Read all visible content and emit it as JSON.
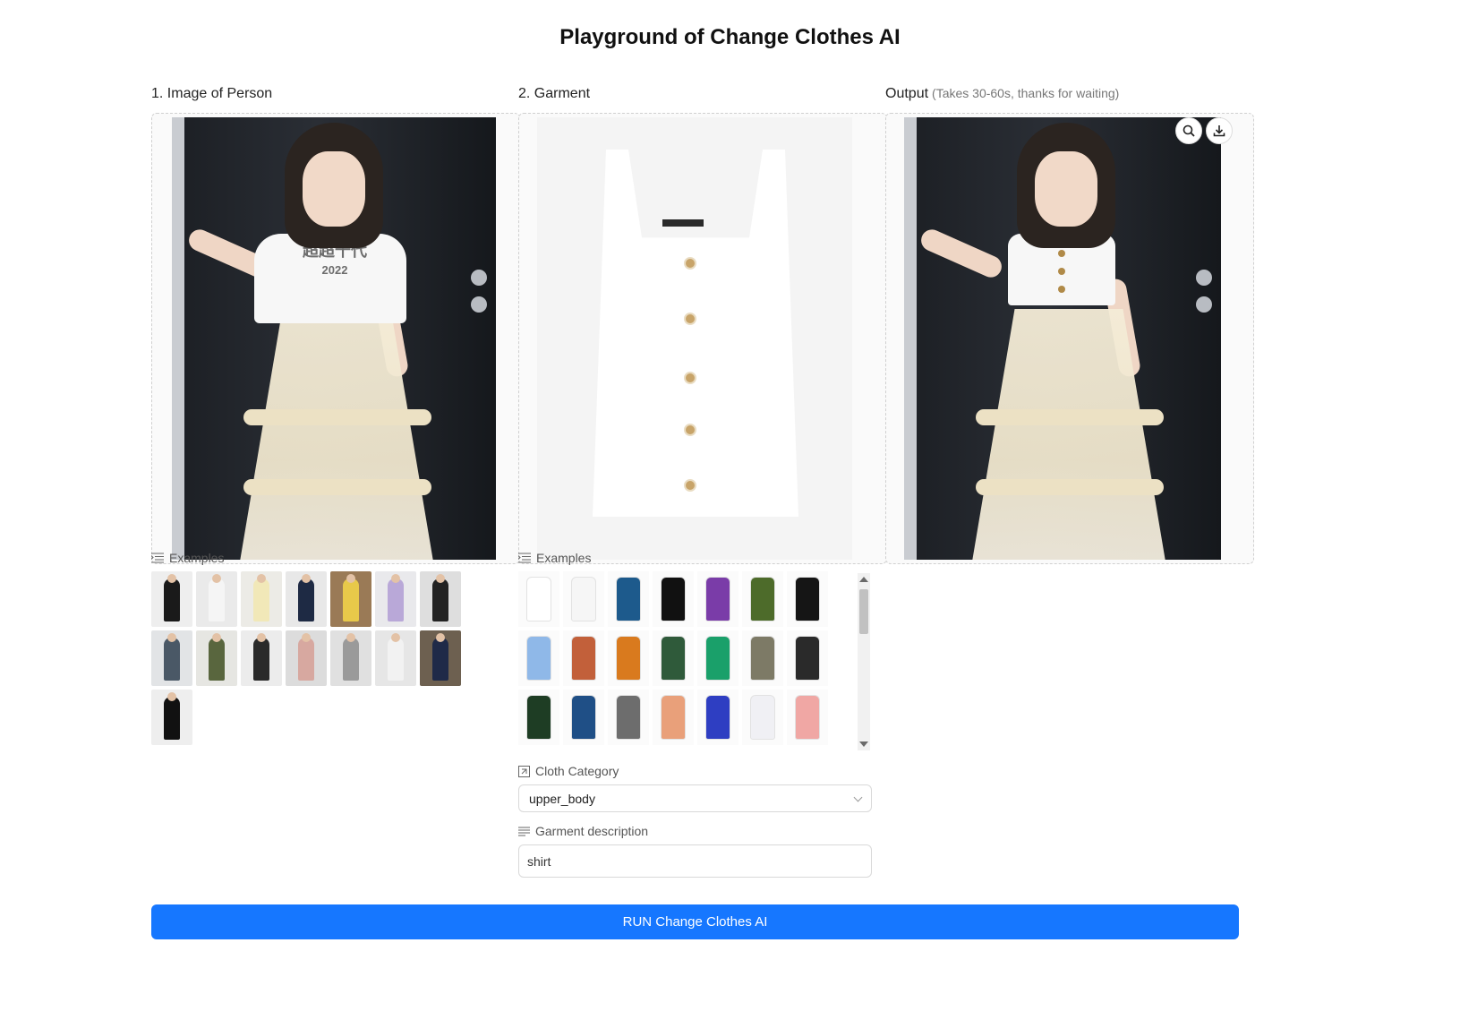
{
  "page": {
    "title": "Playground of Change Clothes AI"
  },
  "columns": {
    "person": {
      "label": "1. Image of Person"
    },
    "garment": {
      "label": "2. Garment"
    },
    "output": {
      "label": "Output",
      "hint": "(Takes 30-60s, thanks for waiting)"
    }
  },
  "person_image": {
    "shirt_text_1": "超超十代",
    "shirt_text_2": "2022"
  },
  "output_actions": {
    "zoom_icon": "magnifier-icon",
    "download_icon": "download-icon"
  },
  "person_examples": {
    "label": "Examples",
    "items": [
      {
        "bg": "#eeeeee",
        "color": "#1a1a1a"
      },
      {
        "bg": "#eaeaea",
        "color": "#f5f5f5"
      },
      {
        "bg": "#ecebe6",
        "color": "#f1e8b8"
      },
      {
        "bg": "#e8e8e8",
        "color": "#1e2a44"
      },
      {
        "bg": "#9a7a56",
        "color": "#e8c94a"
      },
      {
        "bg": "#e9e9ec",
        "color": "#b9a8d8"
      },
      {
        "bg": "#dedede",
        "color": "#222222"
      },
      {
        "bg": "#e2e4e6",
        "color": "#4a5866"
      },
      {
        "bg": "#e6e6e2",
        "color": "#59663e"
      },
      {
        "bg": "#ececec",
        "color": "#2a2a2a"
      },
      {
        "bg": "#dcdcdc",
        "color": "#d7a8a0"
      },
      {
        "bg": "#e0e0e0",
        "color": "#9a9a9a"
      },
      {
        "bg": "#e6e6e6",
        "color": "#f2f2f2"
      },
      {
        "bg": "#6d6050",
        "color": "#1f2a48"
      },
      {
        "bg": "#eeeeee",
        "color": "#111111"
      }
    ]
  },
  "garment_examples": {
    "label": "Examples",
    "items": [
      {
        "color": "#ffffff"
      },
      {
        "color": "#f6f6f6"
      },
      {
        "color": "#1d5a8c"
      },
      {
        "color": "#111111"
      },
      {
        "color": "#7a3ca8"
      },
      {
        "color": "#4d6b2a"
      },
      {
        "color": "#151515"
      },
      {
        "color": "#8fb8e8"
      },
      {
        "color": "#c2603a"
      },
      {
        "color": "#d97a1e"
      },
      {
        "color": "#2f5a3a"
      },
      {
        "color": "#1aa06a"
      },
      {
        "color": "#7d7a66"
      },
      {
        "color": "#2a2a2a"
      },
      {
        "color": "#1e3d24"
      },
      {
        "color": "#1f4f86"
      },
      {
        "color": "#6d6d6d"
      },
      {
        "color": "#e9a07a"
      },
      {
        "color": "#2e3ec2"
      },
      {
        "color": "#f0f0f4"
      },
      {
        "color": "#f0a7a4"
      }
    ]
  },
  "cloth_category": {
    "label": "Cloth Category",
    "value": "upper_body"
  },
  "garment_description": {
    "label": "Garment description",
    "value": "shirt"
  },
  "run_button": {
    "label": "RUN Change Clothes AI"
  },
  "colors": {
    "accent": "#1677ff"
  }
}
